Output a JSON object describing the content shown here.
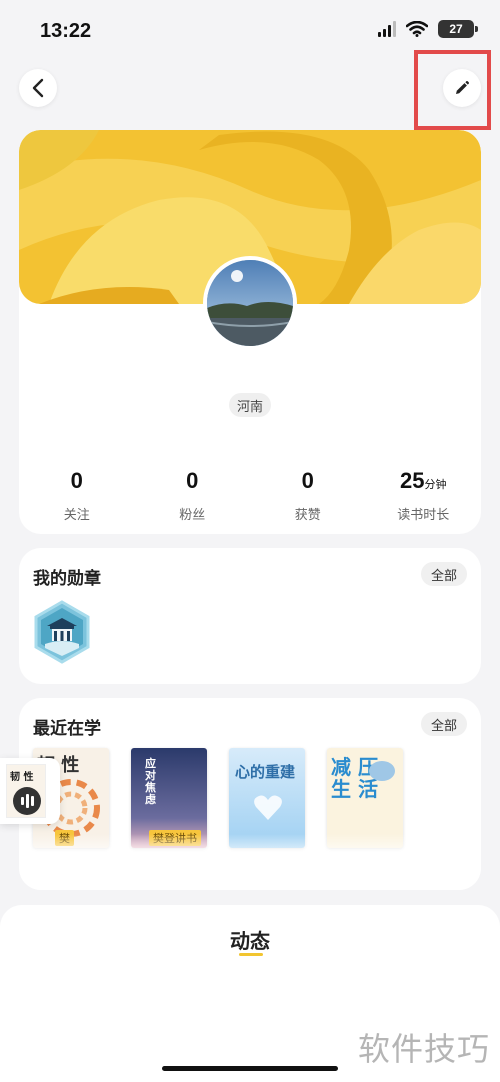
{
  "status_bar": {
    "time": "13:22",
    "battery": "27"
  },
  "header": {
    "back_icon": "chevron-left-icon",
    "edit_icon": "pencil-icon"
  },
  "profile": {
    "region": "河南",
    "stats": [
      {
        "value": "0",
        "unit": "",
        "label": "关注"
      },
      {
        "value": "0",
        "unit": "",
        "label": "粉丝"
      },
      {
        "value": "0",
        "unit": "",
        "label": "获赞"
      },
      {
        "value": "25",
        "unit": "分钟",
        "label": "读书时长"
      }
    ]
  },
  "medals": {
    "title": "我的勋章",
    "all_label": "全部",
    "items": [
      {
        "icon": "temple-medal-icon"
      }
    ]
  },
  "recent_learning": {
    "title": "最近在学",
    "all_label": "全部",
    "books": [
      {
        "title": "韧 性",
        "ribbon": "樊",
        "color": "#f8f1e7"
      },
      {
        "title": "应对焦虑",
        "ribbon": "樊登讲书",
        "color": "#2b3a6b"
      },
      {
        "title": "心的重建",
        "ribbon": "",
        "color": "#d7ebfa"
      },
      {
        "title": "减 压\n生 活",
        "ribbon": "",
        "color": "#fbf3df"
      }
    ]
  },
  "mini_player": {
    "title": "韧 性"
  },
  "feed": {
    "tab_label": "动态"
  },
  "watermark": "软件技巧",
  "colors": {
    "accent_yellow": "#f2c530",
    "highlight_red": "#e24a4a"
  }
}
